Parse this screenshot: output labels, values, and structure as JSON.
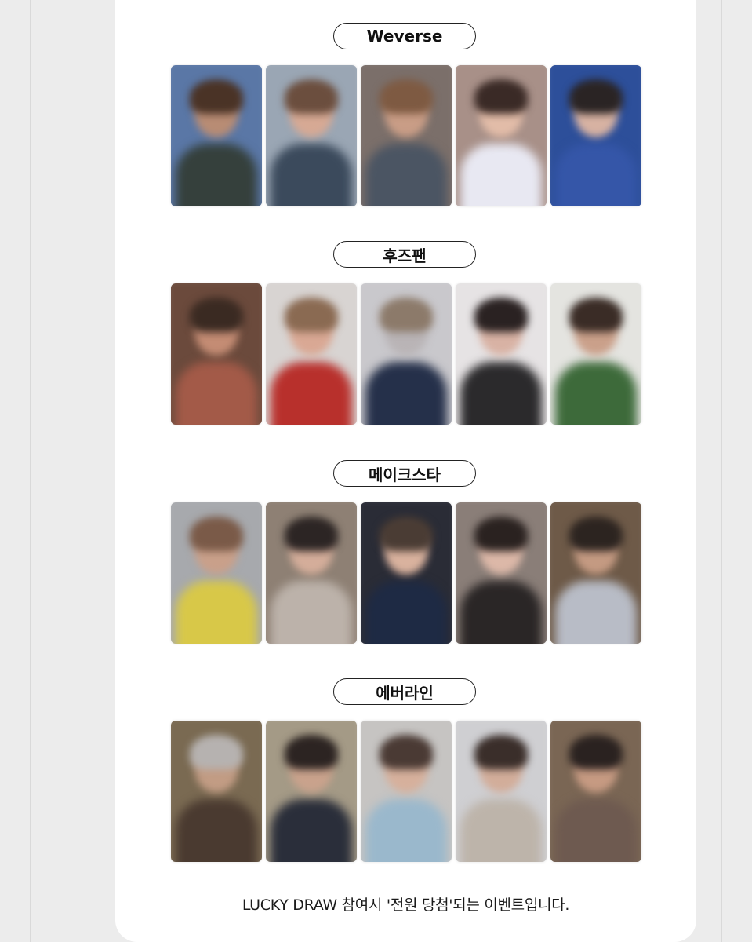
{
  "sections": [
    {
      "label": "Weverse",
      "cards": [
        {
          "bg": "#5a77a6",
          "head": "#b88c74",
          "hair": "#4a3326",
          "body": "#35403c"
        },
        {
          "bg": "#9aa6b4",
          "head": "#d6a994",
          "hair": "#6b4e3e",
          "body": "#3b4a5c"
        },
        {
          "bg": "#7b6f6a",
          "head": "#c99d86",
          "hair": "#7e5a42",
          "body": "#4b5563"
        },
        {
          "bg": "#a89088",
          "head": "#e2bca8",
          "hair": "#3a2a26",
          "body": "#e8e8f2"
        },
        {
          "bg": "#2d4f9a",
          "head": "#d7b2a2",
          "hair": "#2a2424",
          "body": "#3556a8"
        }
      ]
    },
    {
      "label": "후즈팬",
      "cards": [
        {
          "bg": "#6b4a3c",
          "head": "#c48c74",
          "hair": "#3a2a22",
          "body": "#a35a48"
        },
        {
          "bg": "#d8d4d2",
          "head": "#d9a894",
          "hair": "#8a6a52",
          "body": "#b8302c"
        },
        {
          "bg": "#c9c8cc",
          "head": "#b9b4b6",
          "hair": "#8c7a6a",
          "body": "#25304a"
        },
        {
          "bg": "#e6e3e4",
          "head": "#d8b2a4",
          "hair": "#2a2222",
          "body": "#2b2a2c"
        },
        {
          "bg": "#e4e4e0",
          "head": "#caa08a",
          "hair": "#3a2c26",
          "body": "#3d6a3a"
        }
      ]
    },
    {
      "label": "메이크스타",
      "cards": [
        {
          "bg": "#a7a9ad",
          "head": "#c9a08a",
          "hair": "#7a5a48",
          "body": "#d8c848"
        },
        {
          "bg": "#8e8074",
          "head": "#d4ad9a",
          "hair": "#2c2524",
          "body": "#bcb2aa"
        },
        {
          "bg": "#2a2c36",
          "head": "#d9b29e",
          "hair": "#4a3c34",
          "body": "#1e2a44"
        },
        {
          "bg": "#8a7e78",
          "head": "#dcb8a8",
          "hair": "#2a2220",
          "body": "#2a2626"
        },
        {
          "bg": "#6e5a48",
          "head": "#c49a82",
          "hair": "#2c2420",
          "body": "#b8bcc6"
        }
      ]
    },
    {
      "label": "에버라인",
      "cards": [
        {
          "bg": "#7a6a52",
          "head": "#c29c84",
          "hair": "#b6b2b0",
          "body": "#4a3a30"
        },
        {
          "bg": "#a49a86",
          "head": "#c9a28c",
          "hair": "#2c2422",
          "body": "#2a2e3a"
        },
        {
          "bg": "#c6c4c2",
          "head": "#d6b09c",
          "hair": "#4a3a34",
          "body": "#9ab8cc"
        },
        {
          "bg": "#cfcfd2",
          "head": "#d2ad9a",
          "hair": "#3a2e2a",
          "body": "#bdb4aa"
        },
        {
          "bg": "#7a6654",
          "head": "#c69a82",
          "hair": "#2a2220",
          "body": "#6e5a50"
        }
      ]
    }
  ],
  "footer_text": "LUCKY DRAW 참여시 '전원 당첨'되는 이벤트입니다."
}
